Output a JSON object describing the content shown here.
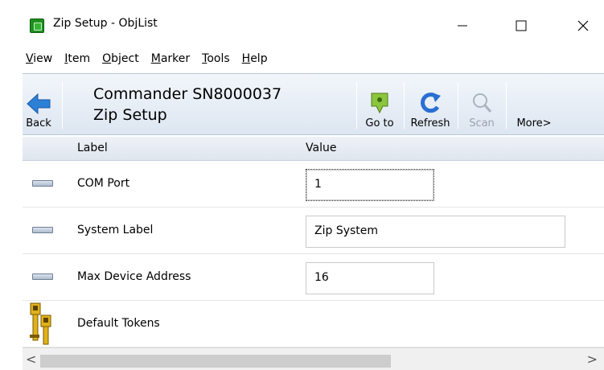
{
  "window": {
    "title": "Zip Setup - ObjList",
    "controls": {
      "minimize": "—",
      "maximize": "☐",
      "close": "✕"
    }
  },
  "menu": [
    {
      "acc": "V",
      "rest": "iew"
    },
    {
      "acc": "I",
      "rest": "tem"
    },
    {
      "acc": "O",
      "rest": "bject"
    },
    {
      "acc": "M",
      "rest": "arker"
    },
    {
      "acc": "T",
      "rest": "ools"
    },
    {
      "acc": "H",
      "rest": "elp"
    }
  ],
  "toolbar": {
    "back_label": "Back",
    "heading_line1": "Commander SN8000037",
    "heading_line2": "Zip Setup",
    "goto_label": "Go to",
    "refresh_label": "Refresh",
    "scan_label": "Scan",
    "more_label": "More>"
  },
  "columns": {
    "label": "Label",
    "value": "Value"
  },
  "rows": [
    {
      "label": "COM Port",
      "value": "1"
    },
    {
      "label": "System Label",
      "value": "Zip System"
    },
    {
      "label": "Max Device Address",
      "value": "16"
    },
    {
      "label": "Default Tokens",
      "value": ""
    }
  ],
  "scrollbar": {
    "left_arrow": "<",
    "right_arrow": ">"
  },
  "colors": {
    "back_arrow": "#2e7fd6",
    "goto_marker": "#8cc63f",
    "refresh": "#2a6fd1",
    "keys": "#e0b21a"
  }
}
